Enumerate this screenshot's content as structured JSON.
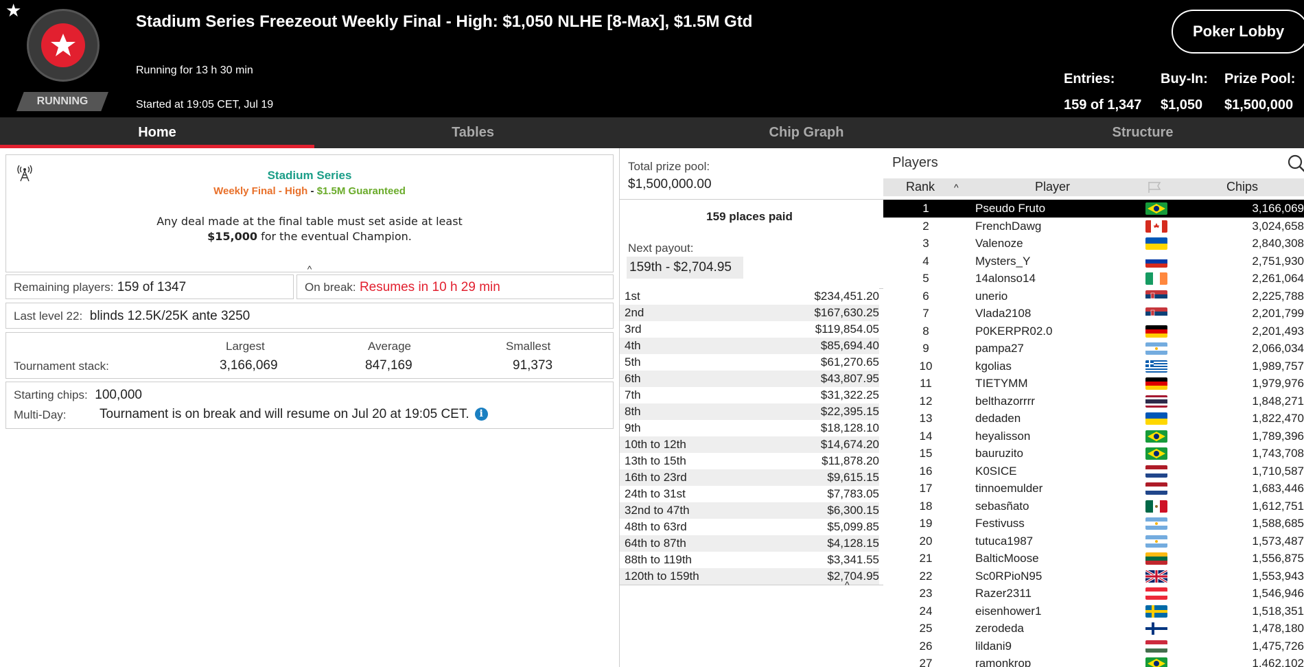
{
  "header": {
    "title": "Stadium Series Freezeout Weekly Final - High: $1,050 NLHE [8-Max], $1.5M Gtd",
    "running_for": "Running for 13 h 30 min",
    "started_at": "Started at 19:05 CET, Jul 19",
    "status": "RUNNING",
    "lobby_button": "Poker Lobby",
    "entries_label": "Entries:",
    "entries_value": "159 of 1,347",
    "buyin_label": "Buy-In:",
    "buyin_value": "$1,050",
    "prizepool_label": "Prize Pool:",
    "prizepool_value": "$1,500,000"
  },
  "tabs": [
    "Home",
    "Tables",
    "Chip Graph",
    "Structure"
  ],
  "home": {
    "series_name": "Stadium Series",
    "series_sub_a": "Weekly Final - High",
    "series_sub_sep": " - ",
    "series_sub_b": "$1.5M Guaranteed",
    "deal_line1": "Any deal made at the final table must set aside at least",
    "deal_amount": "$15,000",
    "deal_line2": " for the eventual Champion.",
    "collapse": "^",
    "remaining_label": "Remaining players:",
    "remaining_value": "159 of 1347",
    "break_label": "On break:",
    "break_value": "Resumes in 10 h 29 min",
    "level_label": "Last level 22:",
    "level_value": "blinds 12.5K/25K ante 3250",
    "stack_label": "Tournament stack:",
    "largest_label": "Largest",
    "largest_value": "3,166,069",
    "average_label": "Average",
    "average_value": "847,169",
    "smallest_label": "Smallest",
    "smallest_value": "91,373",
    "starting_label": "Starting chips:",
    "starting_value": "100,000",
    "multiday_label": "Multi-Day:",
    "multiday_value": "Tournament is on break and will resume on Jul 20 at 19:05 CET.",
    "info_icon": "i"
  },
  "prizes": {
    "total_label": "Total prize pool:",
    "total_value": "$1,500,000.00",
    "places_paid": "159 places paid",
    "next_label": "Next payout:",
    "next_value": "159th - $2,704.95",
    "collapse": "^",
    "rows": [
      {
        "place": "1st",
        "amount": "$234,451.20"
      },
      {
        "place": "2nd",
        "amount": "$167,630.25"
      },
      {
        "place": "3rd",
        "amount": "$119,854.05"
      },
      {
        "place": "4th",
        "amount": "$85,694.40"
      },
      {
        "place": "5th",
        "amount": "$61,270.65"
      },
      {
        "place": "6th",
        "amount": "$43,807.95"
      },
      {
        "place": "7th",
        "amount": "$31,322.25"
      },
      {
        "place": "8th",
        "amount": "$22,395.15"
      },
      {
        "place": "9th",
        "amount": "$18,128.10"
      },
      {
        "place": "10th to 12th",
        "amount": "$14,674.20"
      },
      {
        "place": "13th to 15th",
        "amount": "$11,878.20"
      },
      {
        "place": "16th to 23rd",
        "amount": "$9,615.15"
      },
      {
        "place": "24th to 31st",
        "amount": "$7,783.05"
      },
      {
        "place": "32nd to 47th",
        "amount": "$6,300.15"
      },
      {
        "place": "48th to 63rd",
        "amount": "$5,099.85"
      },
      {
        "place": "64th to 87th",
        "amount": "$4,128.15"
      },
      {
        "place": "88th to 119th",
        "amount": "$3,341.55"
      },
      {
        "place": "120th to 159th",
        "amount": "$2,704.95"
      }
    ]
  },
  "players": {
    "title": "Players",
    "col_rank": "Rank",
    "sort_icon": "^",
    "col_player": "Player",
    "col_chips": "Chips",
    "rows": [
      {
        "rank": "1",
        "name": "Pseudo Fruto",
        "chips": "3,166,069",
        "flag": "brazil"
      },
      {
        "rank": "2",
        "name": "FrenchDawg",
        "chips": "3,024,658",
        "flag": "canada"
      },
      {
        "rank": "3",
        "name": "Valenoze",
        "chips": "2,840,308",
        "flag": "ukraine"
      },
      {
        "rank": "4",
        "name": "Mysters_Y",
        "chips": "2,751,930",
        "flag": "russia"
      },
      {
        "rank": "5",
        "name": "14alonso14",
        "chips": "2,261,064",
        "flag": "ireland"
      },
      {
        "rank": "6",
        "name": "unerio",
        "chips": "2,225,788",
        "flag": "serbia"
      },
      {
        "rank": "7",
        "name": "Vlada2108",
        "chips": "2,201,799",
        "flag": "serbia"
      },
      {
        "rank": "8",
        "name": "P0KERPR02.0",
        "chips": "2,201,493",
        "flag": "germany"
      },
      {
        "rank": "9",
        "name": "pampa27",
        "chips": "2,066,034",
        "flag": "argentina"
      },
      {
        "rank": "10",
        "name": "kgolias",
        "chips": "1,989,757",
        "flag": "greece"
      },
      {
        "rank": "11",
        "name": "TIETYMM",
        "chips": "1,979,976",
        "flag": "germany"
      },
      {
        "rank": "12",
        "name": "belthazorrrr",
        "chips": "1,848,271",
        "flag": "thailand"
      },
      {
        "rank": "13",
        "name": "dedaden",
        "chips": "1,822,470",
        "flag": "ukraine"
      },
      {
        "rank": "14",
        "name": "heyalisson",
        "chips": "1,789,396",
        "flag": "brazil"
      },
      {
        "rank": "15",
        "name": "bauruzito",
        "chips": "1,743,708",
        "flag": "brazil"
      },
      {
        "rank": "16",
        "name": "K0SICE",
        "chips": "1,710,587",
        "flag": "netherlands"
      },
      {
        "rank": "17",
        "name": "tinnoemulder",
        "chips": "1,683,446",
        "flag": "netherlands"
      },
      {
        "rank": "18",
        "name": "sebasñato",
        "chips": "1,612,751",
        "flag": "mexico"
      },
      {
        "rank": "19",
        "name": "Festivuss",
        "chips": "1,588,685",
        "flag": "argentina"
      },
      {
        "rank": "20",
        "name": "tutuca1987",
        "chips": "1,573,487",
        "flag": "argentina"
      },
      {
        "rank": "21",
        "name": "BalticMoose",
        "chips": "1,556,875",
        "flag": "lithuania"
      },
      {
        "rank": "22",
        "name": "Sc0RPioN95",
        "chips": "1,553,943",
        "flag": "uk"
      },
      {
        "rank": "23",
        "name": "Razer2311",
        "chips": "1,546,946",
        "flag": "austria"
      },
      {
        "rank": "24",
        "name": "eisenhower1",
        "chips": "1,518,351",
        "flag": "sweden"
      },
      {
        "rank": "25",
        "name": "zerodeda",
        "chips": "1,478,180",
        "flag": "finland"
      },
      {
        "rank": "26",
        "name": "lildani9",
        "chips": "1,475,726",
        "flag": "hungary"
      },
      {
        "rank": "27",
        "name": "ramonkrop",
        "chips": "1,462,102",
        "flag": "brazil"
      }
    ]
  },
  "colors": {
    "accent": "#e2202f",
    "series_teal": "#1a9d87",
    "series_orange": "#e8702a",
    "series_green": "#6aab2a",
    "info_blue": "#1a7fc1"
  }
}
